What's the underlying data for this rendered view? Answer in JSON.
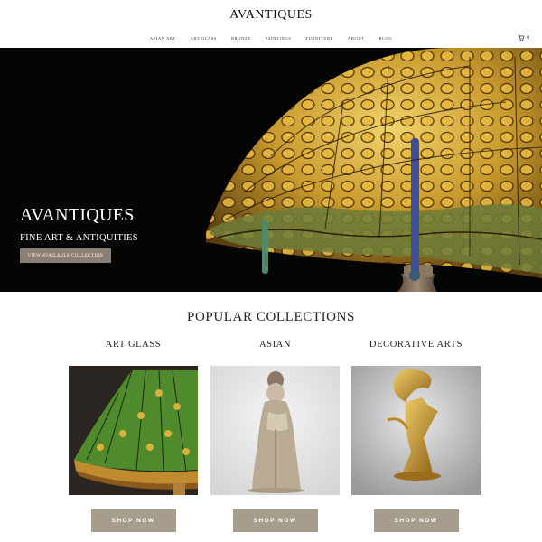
{
  "header": {
    "logo": "AVANTIQUES",
    "nav": [
      "ASIAN ART",
      "ART GLASS",
      "BRONZE",
      "PAINTINGS",
      "FURNITURE",
      "ABOUT",
      "BLOG"
    ],
    "cart_count": "0"
  },
  "hero": {
    "title": "AVANTIQUES",
    "subtitle": "FINE ART & ANTIQUITIES",
    "button_label": "VIEW AVAILABLE COLLECTION"
  },
  "collections": {
    "title": "POPULAR COLLECTIONS",
    "items": [
      {
        "name": "ART GLASS",
        "button_label": "SHOP NOW"
      },
      {
        "name": "ASIAN",
        "button_label": "SHOP NOW"
      },
      {
        "name": "DECORATIVE ARTS",
        "button_label": "SHOP NOW"
      }
    ]
  },
  "colors": {
    "accent_button": "#a79d8d",
    "hero_button": "#8a7f72",
    "hero_background": "#050505"
  }
}
